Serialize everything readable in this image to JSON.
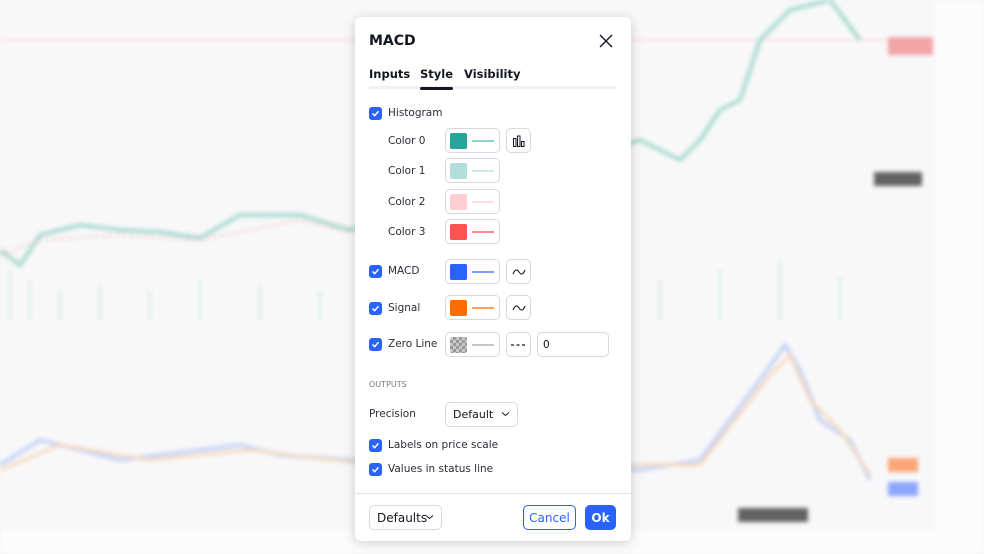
{
  "dialog": {
    "title": "MACD",
    "tabs": [
      {
        "label": "Inputs"
      },
      {
        "label": "Style",
        "active": true
      },
      {
        "label": "Visibility"
      }
    ],
    "histogram": {
      "label": "Histogram",
      "checked": true,
      "colors": [
        {
          "label": "Color 0",
          "color": "#26a69a"
        },
        {
          "label": "Color 1",
          "color": "#b2dfdb"
        },
        {
          "label": "Color 2",
          "color": "#ffcdd2"
        },
        {
          "label": "Color 3",
          "color": "#ff5252"
        }
      ],
      "style_icon": "histogram-bars-icon"
    },
    "macd": {
      "label": "MACD",
      "checked": true,
      "color": "#2962ff",
      "style_icon": "line-wave-icon"
    },
    "signal": {
      "label": "Signal",
      "checked": true,
      "color": "#ff6d00",
      "style_icon": "line-wave-icon"
    },
    "zero_line": {
      "label": "Zero Line",
      "checked": true,
      "color": "transparent",
      "style_icon": "dashed-line-icon",
      "value": "0"
    },
    "outputs_header": "OUTPUTS",
    "precision": {
      "label": "Precision",
      "value": "Default"
    },
    "labels_on_price_scale": {
      "label": "Labels on price scale",
      "checked": true
    },
    "values_in_status_line": {
      "label": "Values in status line",
      "checked": true
    },
    "footer": {
      "defaults": "Defaults",
      "cancel": "Cancel",
      "ok": "Ok"
    }
  },
  "colors": {
    "accent": "#2962ff",
    "up": "#26a69a",
    "down": "#ef5350"
  }
}
